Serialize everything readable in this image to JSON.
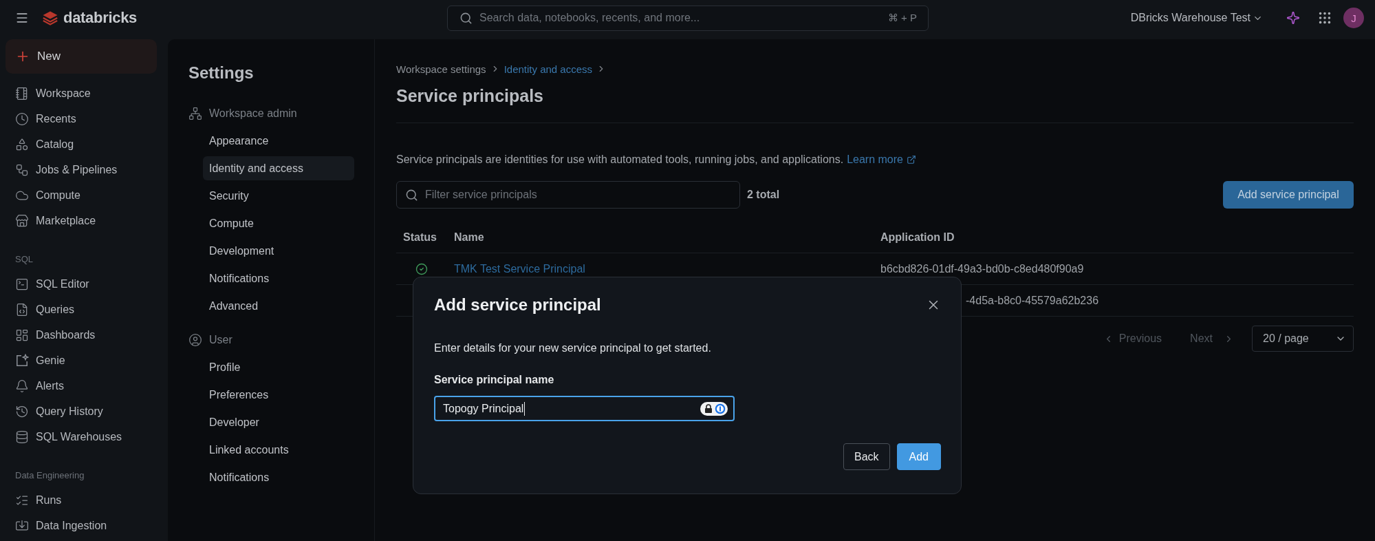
{
  "top_bar": {
    "logo": "databricks",
    "search": {
      "placeholder": "Search data, notebooks, recents, and more...",
      "shortcut": "⌘ + P"
    },
    "workspace": "DBricks Warehouse Test",
    "avatar": "J"
  },
  "sidebar": {
    "new_button": "New",
    "sections": [
      {
        "items": [
          {
            "label": "Workspace",
            "selected": false
          },
          {
            "label": "Recents",
            "selected": false
          },
          {
            "label": "Catalog",
            "selected": false
          },
          {
            "label": "Jobs & Pipelines",
            "selected": false
          },
          {
            "label": "Compute",
            "selected": false
          },
          {
            "label": "Marketplace",
            "selected": false
          }
        ]
      },
      {
        "heading": "SQL",
        "items": [
          {
            "label": "SQL Editor",
            "selected": false
          },
          {
            "label": "Queries",
            "selected": false
          },
          {
            "label": "Dashboards",
            "selected": false
          },
          {
            "label": "Genie",
            "selected": false
          },
          {
            "label": "Alerts",
            "selected": false
          },
          {
            "label": "Query History",
            "selected": false
          },
          {
            "label": "SQL Warehouses",
            "selected": false
          }
        ]
      },
      {
        "heading": "Data Engineering",
        "items": [
          {
            "label": "Runs",
            "selected": false
          },
          {
            "label": "Data Ingestion",
            "selected": false
          }
        ]
      }
    ]
  },
  "settings": {
    "title": "Settings",
    "groups": [
      {
        "heading": "Workspace admin",
        "items": [
          {
            "label": "Appearance",
            "selected": false
          },
          {
            "label": "Identity and access",
            "selected": true
          },
          {
            "label": "Security",
            "selected": false
          },
          {
            "label": "Compute",
            "selected": false
          },
          {
            "label": "Development",
            "selected": false
          },
          {
            "label": "Notifications",
            "selected": false
          },
          {
            "label": "Advanced",
            "selected": false
          }
        ]
      },
      {
        "heading": "User",
        "items": [
          {
            "label": "Profile",
            "selected": false
          },
          {
            "label": "Preferences",
            "selected": false
          },
          {
            "label": "Developer",
            "selected": false
          },
          {
            "label": "Linked accounts",
            "selected": false
          },
          {
            "label": "Notifications",
            "selected": false
          }
        ]
      }
    ]
  },
  "main": {
    "breadcrumb": [
      {
        "label": "Workspace settings",
        "kind": "plain"
      },
      {
        "label": "Identity and access",
        "kind": "link"
      }
    ],
    "title": "Service principals",
    "description": "Service principals are identities for use with automated tools, running jobs, and applications.",
    "learn_more": "Learn more",
    "filter": {
      "placeholder": "Filter service principals"
    },
    "total": "2 total",
    "add_button": "Add service principal",
    "table": {
      "columns": [
        "Status",
        "Name",
        "Application ID"
      ],
      "rows": [
        {
          "active": true,
          "name": "TMK Test Service Principal",
          "application_id": "b6cbd826-01df-49a3-bd0b-c8ed480f90a9"
        },
        {
          "application_id": "-4d5a-b8c0-45579a62b236"
        }
      ]
    },
    "pagination": {
      "previous": {
        "label": "Previous",
        "disabled": true
      },
      "next": {
        "label": "Next",
        "disabled": true
      },
      "page_size": "20 / page"
    }
  },
  "dialog": {
    "title": "Add service principal",
    "description": "Enter details for your new service principal to get started.",
    "field": {
      "label": "Service principal name",
      "value": "Topogy Principal",
      "focused": true
    },
    "buttons": [
      {
        "label": "Back",
        "kind": "secondary"
      },
      {
        "label": "Add",
        "kind": "primary"
      }
    ]
  }
}
